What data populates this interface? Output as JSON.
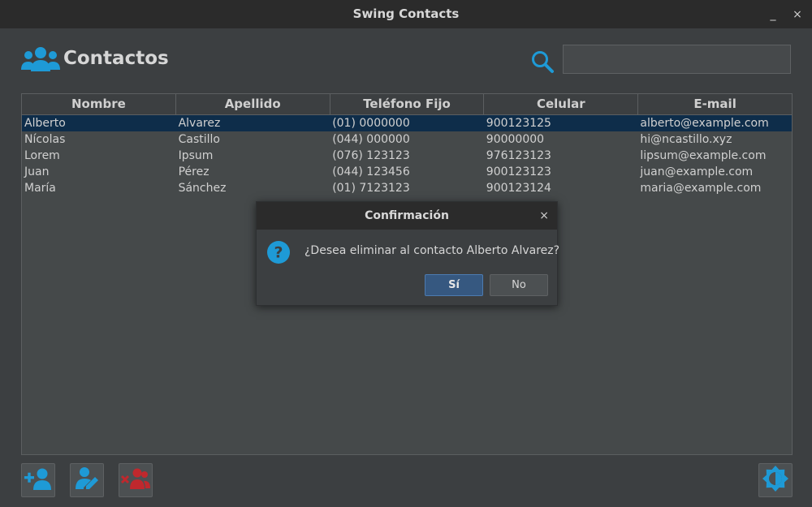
{
  "window": {
    "title": "Swing Contacts",
    "minimize": "_",
    "close": "×"
  },
  "header": {
    "title": "Contactos"
  },
  "search": {
    "value": "",
    "placeholder": ""
  },
  "table": {
    "columns": [
      "Nombre",
      "Apellido",
      "Teléfono Fijo",
      "Celular",
      "E-mail"
    ],
    "rows": [
      [
        "Alberto",
        "Alvarez",
        "(01) 0000000",
        "900123125",
        "alberto@example.com"
      ],
      [
        "Nícolas",
        "Castillo",
        "(044) 000000",
        "90000000",
        "hi@ncastillo.xyz"
      ],
      [
        "Lorem",
        "Ipsum",
        "(076) 123123",
        "976123123",
        "lipsum@example.com"
      ],
      [
        "Juan",
        "Pérez",
        "(044) 123456",
        "900123123",
        "juan@example.com"
      ],
      [
        "María",
        "Sánchez",
        "(01) 7123123",
        "900123124",
        "maria@example.com"
      ]
    ],
    "selected_row": 0
  },
  "dialog": {
    "title": "Confirmación",
    "close": "×",
    "message": "¿Desea eliminar al contacto Alberto Alvarez?",
    "yes_label": "Sí",
    "no_label": "No"
  },
  "colors": {
    "accent": "#1e9ad6",
    "danger": "#c0282d",
    "selection": "#0e2d4a"
  },
  "toolbar": {
    "icons": [
      "add-user-icon",
      "edit-user-icon",
      "delete-users-icon",
      "theme-toggle-icon"
    ]
  }
}
